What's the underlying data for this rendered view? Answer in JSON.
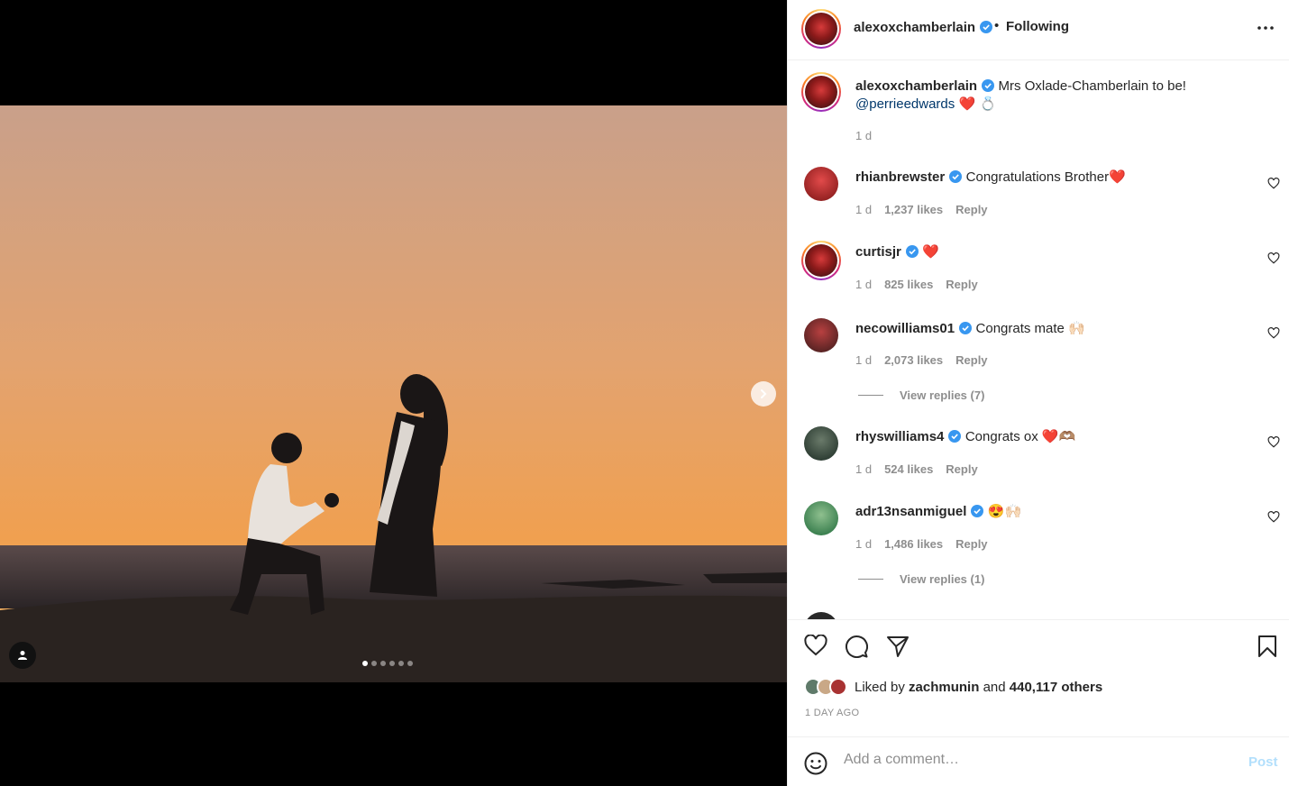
{
  "post": {
    "username": "alexoxchamberlain",
    "separator": "•",
    "follow_status": "Following",
    "caption_text": "Mrs Oxlade-Chamberlain to be!",
    "caption_mention": "@perrieedwards",
    "caption_emoji": "❤️ 💍",
    "caption_time": "1 d"
  },
  "comments": [
    {
      "username": "rhianbrewster",
      "text": "Congratulations Brother❤️",
      "time": "1 d",
      "likes": "1,237 likes",
      "reply": "Reply"
    },
    {
      "username": "curtisjr",
      "text": "❤️",
      "time": "1 d",
      "likes": "825 likes",
      "reply": "Reply"
    },
    {
      "username": "necowilliams01",
      "text": "Congrats mate 🙌🏻",
      "time": "1 d",
      "likes": "2,073 likes",
      "reply": "Reply",
      "view_replies": "View replies (7)"
    },
    {
      "username": "rhyswilliams4",
      "text": "Congrats ox ❤️🫶🏽",
      "time": "1 d",
      "likes": "524 likes",
      "reply": "Reply"
    },
    {
      "username": "adr13nsanmiguel",
      "text": "😍🙌🏻",
      "time": "1 d",
      "likes": "1,486 likes",
      "reply": "Reply",
      "view_replies": "View replies (1)"
    }
  ],
  "likes": {
    "prefix": "Liked by",
    "first_user": "zachmunin",
    "and_text": "and",
    "others": "440,117 others"
  },
  "timestamp": "1 DAY AGO",
  "comment_box": {
    "placeholder": "Add a comment…",
    "post_label": "Post"
  },
  "carousel": {
    "count": 6,
    "active": 0
  },
  "colors": {
    "accent": "#0095f6",
    "post_disabled": "#b2dffc",
    "verified": "#3897f0"
  }
}
